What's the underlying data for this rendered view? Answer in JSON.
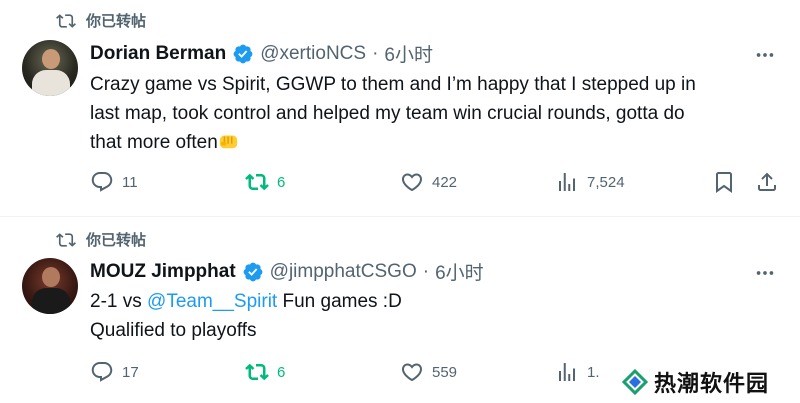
{
  "tweets": [
    {
      "retweet_label": "你已转帖",
      "author_name": "Dorian Berman",
      "handle": "@xertioNCS",
      "separator": "·",
      "time": "6小时",
      "text_parts": {
        "line1": "Crazy game vs Spirit, GGWP to them and I’m happy that I stepped up in",
        "line2": "last map, took control and helped my team win crucial rounds, gotta do",
        "line3": "that more often"
      },
      "emoji": "fist-emoji",
      "counts": {
        "replies": "11",
        "retweets": "6",
        "likes": "422",
        "views": "7,524"
      }
    },
    {
      "retweet_label": "你已转帖",
      "author_name": "MOUZ Jimpphat",
      "handle": "@jimpphatCSGO",
      "separator": "·",
      "time": "6小时",
      "text_parts": {
        "prefix": "2-1 vs ",
        "mention": "@Team__Spirit",
        "suffix": " Fun games :D",
        "line2": "Qualified to playoffs"
      },
      "counts": {
        "replies": "17",
        "retweets": "6",
        "likes": "559",
        "views": "1."
      }
    }
  ],
  "watermark": {
    "text": "热潮软件园",
    "icon": "diamond-logo-icon"
  },
  "colors": {
    "retweet_green": "#00ba7c",
    "link_blue": "#1d9bf0",
    "muted": "#536471",
    "verified": "#1d9bf0"
  }
}
